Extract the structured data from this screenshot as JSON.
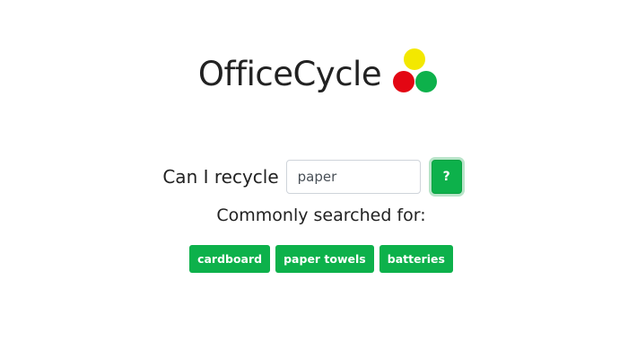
{
  "header": {
    "app_name": "OfficeCycle",
    "logo_icon": "three-dots-logo-icon",
    "logo_colors": {
      "yellow": "#f3e800",
      "red": "#e30613",
      "green": "#0db14b"
    }
  },
  "search": {
    "prompt": "Can I recycle",
    "value": "paper",
    "submit_label": "?"
  },
  "common": {
    "label": "Commonly searched for:",
    "items": [
      {
        "label": "cardboard"
      },
      {
        "label": "paper towels"
      },
      {
        "label": "batteries"
      }
    ]
  },
  "colors": {
    "accent": "#0db14b",
    "text": "#222222"
  }
}
